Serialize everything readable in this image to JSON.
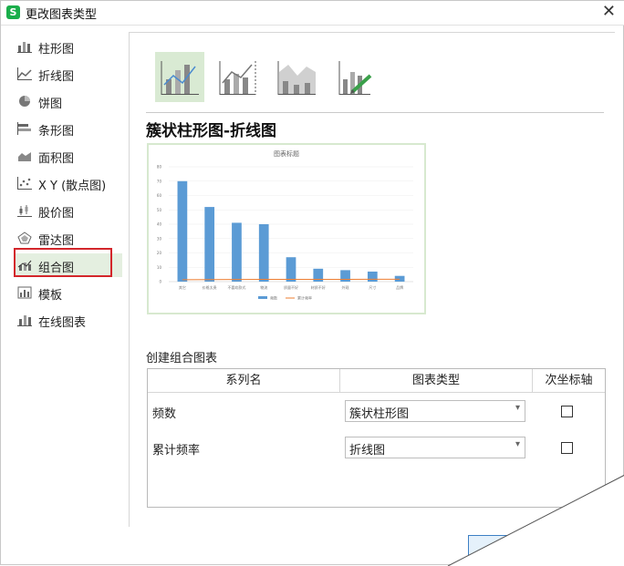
{
  "dialog": {
    "title": "更改图表类型",
    "app_icon_letter": "S"
  },
  "sidebar": {
    "items": [
      {
        "label": "柱形图",
        "icon": "column-chart-icon"
      },
      {
        "label": "折线图",
        "icon": "line-chart-icon"
      },
      {
        "label": "饼图",
        "icon": "pie-chart-icon"
      },
      {
        "label": "条形图",
        "icon": "bar-chart-icon"
      },
      {
        "label": "面积图",
        "icon": "area-chart-icon"
      },
      {
        "label": "X Y (散点图)",
        "icon": "scatter-chart-icon"
      },
      {
        "label": "股价图",
        "icon": "stock-chart-icon"
      },
      {
        "label": "雷达图",
        "icon": "radar-chart-icon"
      },
      {
        "label": "组合图",
        "icon": "combo-chart-icon",
        "selected": true
      },
      {
        "label": "模板",
        "icon": "template-icon"
      },
      {
        "label": "在线图表",
        "icon": "online-chart-icon"
      }
    ]
  },
  "main": {
    "heading": "簇状柱形图-折线图",
    "preview_title": "图表标题",
    "create_label": "创建组合图表",
    "table": {
      "headers": [
        "系列名",
        "图表类型",
        "次坐标轴"
      ],
      "rows": [
        {
          "name": "频数",
          "type": "簇状柱形图",
          "secondary": false
        },
        {
          "name": "累计频率",
          "type": "折线图",
          "secondary": false
        }
      ]
    }
  },
  "chart_data": {
    "type": "bar",
    "title": "图表标题",
    "categories": [
      "其它",
      "价格太贵",
      "不喜欢款式",
      "物流",
      "质量不好",
      "材质不好",
      "外观",
      "尺寸",
      "品牌"
    ],
    "series": [
      {
        "name": "频数",
        "type": "bar",
        "values": [
          70,
          52,
          41,
          40,
          17,
          9,
          8,
          7,
          4
        ]
      },
      {
        "name": "累计频率",
        "type": "line",
        "values": [
          0.2,
          0.4,
          0.6,
          0.8,
          0.85,
          0.9,
          0.93,
          0.96,
          1.0
        ]
      }
    ],
    "ylim": [
      0,
      80
    ],
    "yticks": [
      0,
      10,
      20,
      30,
      40,
      50,
      60,
      70,
      80
    ],
    "colors": {
      "bar": "#5b9bd5",
      "line": "#ed7d31"
    }
  }
}
